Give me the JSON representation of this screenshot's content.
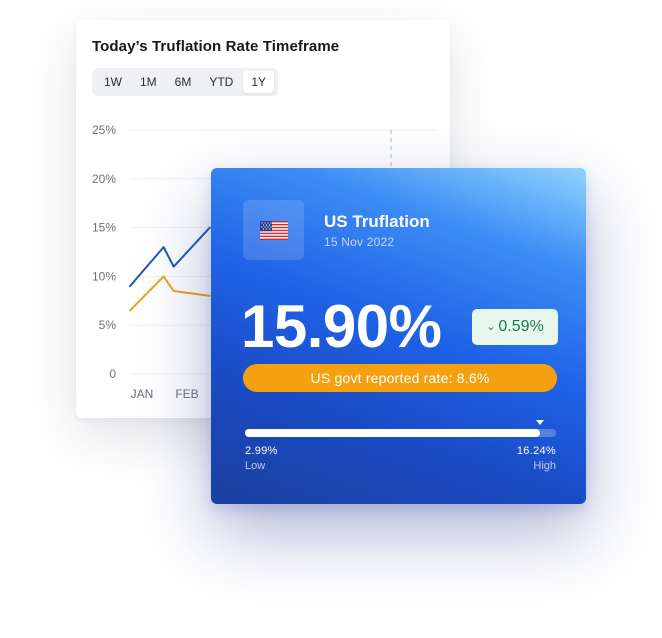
{
  "chart_card": {
    "title": "Today’s Truflation Rate Timeframe",
    "tabs": [
      {
        "label": "1W",
        "active": false
      },
      {
        "label": "1M",
        "active": false
      },
      {
        "label": "6M",
        "active": false
      },
      {
        "label": "YTD",
        "active": false
      },
      {
        "label": "1Y",
        "active": true
      }
    ]
  },
  "chart_data": {
    "type": "line",
    "title": "Today’s Truflation Rate Timeframe",
    "y_ticks": [
      "25%",
      "20%",
      "15%",
      "10%",
      "5%",
      "0"
    ],
    "ylim": [
      0,
      25
    ],
    "x_ticks": [
      "JAN",
      "FEB"
    ],
    "grid": true,
    "x": [
      0,
      0.4,
      0.52,
      0.95
    ],
    "series": [
      {
        "color": "#1f5ab8",
        "values": [
          9,
          13,
          11,
          15
        ]
      },
      {
        "color": "#f0a21a",
        "values": [
          6.5,
          10,
          8.5,
          8
        ]
      }
    ]
  },
  "card": {
    "flag_icon": "us-flag-icon",
    "title": "US Truflation",
    "date": "15 Nov 2022",
    "rate": "15.90%",
    "change": "0.59%",
    "change_direction": "down",
    "govt_rate": "US govt reported rate: 8.6%",
    "range": {
      "low_value": "2.99%",
      "low_label": "Low",
      "high_value": "16.24%",
      "high_label": "High",
      "position": 0.95
    },
    "colors": {
      "accent": "#1f62e6",
      "badge_bg": "#e7f7ee",
      "badge_text": "#1a7a46",
      "pill": "#f5a10f"
    }
  }
}
